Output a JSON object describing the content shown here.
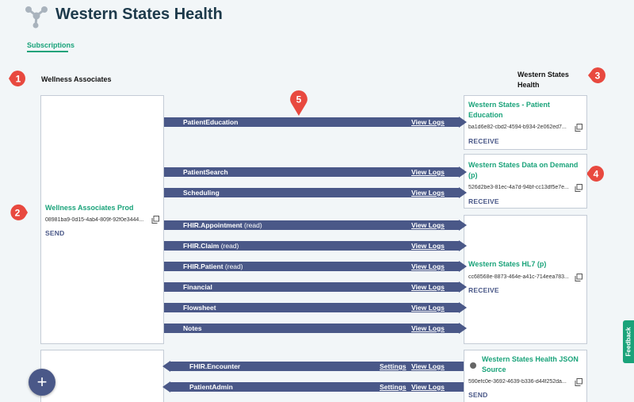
{
  "header": {
    "title": "Western States Health",
    "logo_icon": "network-nodes-icon"
  },
  "tabs": [
    {
      "label": "Subscriptions",
      "active": true
    }
  ],
  "badges": [
    "1",
    "2",
    "3",
    "4",
    "5"
  ],
  "colors": {
    "accent": "#1aa37a",
    "arrow": "#4a5888",
    "badge": "#e8493f",
    "title": "#1d3a4b"
  },
  "left_org": {
    "label": "Wellness Associates"
  },
  "right_org": {
    "label_line1": "Western States",
    "label_line2": "Health"
  },
  "endpoints": {
    "wa_prod": {
      "name": "Wellness Associates Prod",
      "id": "08981ba9-0d15-4ab4-809f-92f0e3444...",
      "direction": "SEND"
    },
    "patient_education": {
      "name_line1": "Western States - Patient",
      "name_line2": "Education",
      "id": "ba1d6e82-cbd2-4594-b934-2e062ed7...",
      "direction": "RECEIVE"
    },
    "data_on_demand": {
      "name_line1": "Western States Data on Demand",
      "name_line2": "(p)",
      "id": "526d2be3-81ec-4a7d-94bf-cc13df5e7e...",
      "direction": "RECEIVE"
    },
    "hl7": {
      "name": "Western States HL7 (p)",
      "id": "cc68568e-8873-464e-a41c-714eea783...",
      "direction": "RECEIVE"
    },
    "json_source": {
      "name_line1": "Western States Health JSON",
      "name_line2": "Source",
      "id": "590efc0e-3692-4639-b336-d44f252da...",
      "direction": "SEND"
    }
  },
  "links": {
    "view_logs": "View Logs",
    "settings": "Settings"
  },
  "arrows": [
    {
      "name": "PatientEducation",
      "suffix": ""
    },
    {
      "name": "PatientSearch",
      "suffix": ""
    },
    {
      "name": "Scheduling",
      "suffix": ""
    },
    {
      "name": "FHIR.Appointment",
      "suffix": "(read)"
    },
    {
      "name": "FHIR.Claim",
      "suffix": "(read)"
    },
    {
      "name": "FHIR.Patient",
      "suffix": "(read)"
    },
    {
      "name": "Financial",
      "suffix": ""
    },
    {
      "name": "Flowsheet",
      "suffix": ""
    },
    {
      "name": "Notes",
      "suffix": ""
    },
    {
      "name": "FHIR.Encounter",
      "suffix": ""
    },
    {
      "name": "PatientAdmin",
      "suffix": ""
    }
  ],
  "feedback": {
    "label": "Feedback"
  },
  "fab": {
    "label": "+"
  }
}
